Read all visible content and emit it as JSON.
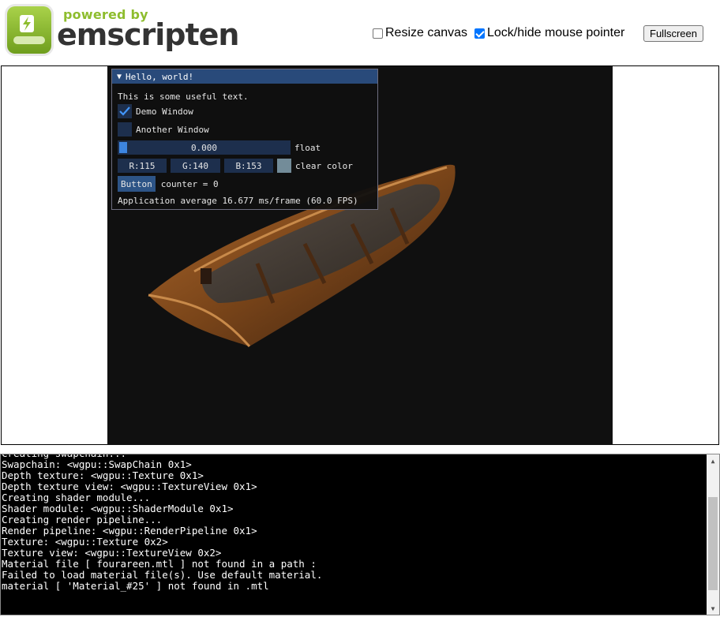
{
  "header": {
    "powered_by": "powered by",
    "brand": "emscripten",
    "resize_canvas": {
      "label": "Resize canvas",
      "checked": false
    },
    "lock_pointer": {
      "label": "Lock/hide mouse pointer",
      "checked": true
    },
    "fullscreen_label": "Fullscreen"
  },
  "imgui": {
    "title": "Hello, world!",
    "text": "This is some useful text.",
    "demo_window": {
      "label": "Demo Window",
      "checked": true
    },
    "another_window": {
      "label": "Another Window",
      "checked": false
    },
    "slider": {
      "value": "0.000",
      "label": "float",
      "fraction": 0.0
    },
    "color": {
      "r": "R:115",
      "g": "G:140",
      "b": "B:153",
      "label": "clear color",
      "swatch": "#738c99"
    },
    "button_label": "Button",
    "counter": "counter = 0",
    "fps": "Application average 16.677 ms/frame (60.0 FPS)"
  },
  "console": {
    "lines": [
      "Creating swapchain...",
      "Swapchain: <wgpu::SwapChain 0x1>",
      "Depth texture: <wgpu::Texture 0x1>",
      "Depth texture view: <wgpu::TextureView 0x1>",
      "Creating shader module...",
      "Shader module: <wgpu::ShaderModule 0x1>",
      "Creating render pipeline...",
      "Render pipeline: <wgpu::RenderPipeline 0x1>",
      "Texture: <wgpu::Texture 0x2>",
      "Texture view: <wgpu::TextureView 0x2>",
      "Material file [ fourareen.mtl ] not found in a path :",
      "Failed to load material file(s). Use default material.",
      "material [ 'Material_#25' ] not found in .mtl"
    ]
  },
  "colors": {
    "brand_green": "#8ebd2e",
    "imgui_title": "#294a7a",
    "imgui_frame": "#1d2f4d",
    "imgui_button": "#2d5486",
    "checkbox_blue": "#0075ff"
  }
}
